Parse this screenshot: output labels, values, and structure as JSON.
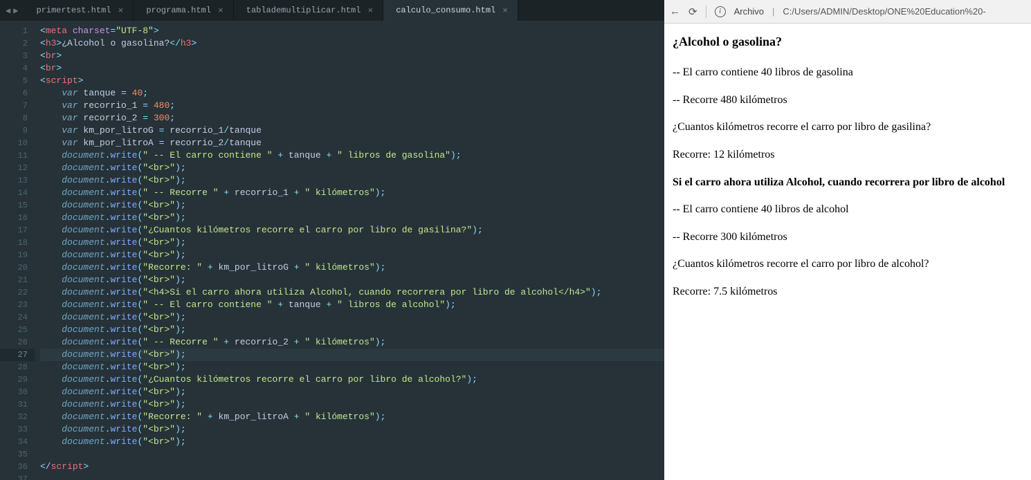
{
  "tabs": {
    "nav_prev": "◀",
    "nav_next": "▶",
    "items": [
      {
        "label": "primertest.html",
        "active": false
      },
      {
        "label": "programa.html",
        "active": false
      },
      {
        "label": "tablademultiplicar.html",
        "active": false
      },
      {
        "label": "calculo_consumo.html",
        "active": true
      }
    ],
    "close_glyph": "×"
  },
  "gutter": {
    "start": 1,
    "end": 37,
    "highlight": 27
  },
  "code_lines": [
    [
      {
        "c": "t-cyan",
        "t": "<"
      },
      {
        "c": "t-red",
        "t": "meta "
      },
      {
        "c": "t-purple",
        "t": "charset"
      },
      {
        "c": "t-cyan",
        "t": "="
      },
      {
        "c": "t-green",
        "t": "\"UTF-8\""
      },
      {
        "c": "t-cyan",
        "t": ">"
      }
    ],
    [
      {
        "c": "t-cyan",
        "t": "<"
      },
      {
        "c": "t-red",
        "t": "h3"
      },
      {
        "c": "t-cyan",
        "t": ">"
      },
      {
        "c": "t-gray",
        "t": "¿Alcohol o gasolina?"
      },
      {
        "c": "t-cyan",
        "t": "</"
      },
      {
        "c": "t-red",
        "t": "h3"
      },
      {
        "c": "t-cyan",
        "t": ">"
      }
    ],
    [
      {
        "c": "t-cyan",
        "t": "<"
      },
      {
        "c": "t-red",
        "t": "br"
      },
      {
        "c": "t-cyan",
        "t": ">"
      }
    ],
    [
      {
        "c": "t-cyan",
        "t": "<"
      },
      {
        "c": "t-red",
        "t": "br"
      },
      {
        "c": "t-cyan",
        "t": ">"
      }
    ],
    [
      {
        "c": "t-cyan",
        "t": "<"
      },
      {
        "c": "t-red",
        "t": "script"
      },
      {
        "c": "t-cyan",
        "t": ">"
      }
    ],
    [
      {
        "c": "",
        "t": "    "
      },
      {
        "c": "t-purple t-ital",
        "t": "var"
      },
      {
        "c": "t-gray",
        "t": " tanque "
      },
      {
        "c": "t-cyan",
        "t": "= "
      },
      {
        "c": "t-orange",
        "t": "40"
      },
      {
        "c": "t-cyan",
        "t": ";"
      }
    ],
    [
      {
        "c": "",
        "t": "    "
      },
      {
        "c": "t-purple t-ital",
        "t": "var"
      },
      {
        "c": "t-gray",
        "t": " recorrio_1 "
      },
      {
        "c": "t-cyan",
        "t": "= "
      },
      {
        "c": "t-orange",
        "t": "480"
      },
      {
        "c": "t-cyan",
        "t": ";"
      }
    ],
    [
      {
        "c": "",
        "t": "    "
      },
      {
        "c": "t-purple t-ital",
        "t": "var"
      },
      {
        "c": "t-gray",
        "t": " recorrio_2 "
      },
      {
        "c": "t-cyan",
        "t": "= "
      },
      {
        "c": "t-orange",
        "t": "300"
      },
      {
        "c": "t-cyan",
        "t": ";"
      }
    ],
    [
      {
        "c": "",
        "t": "    "
      },
      {
        "c": "t-purple t-ital",
        "t": "var"
      },
      {
        "c": "t-gray",
        "t": " km_por_litroG "
      },
      {
        "c": "t-cyan",
        "t": "= "
      },
      {
        "c": "t-gray",
        "t": "recorrio_1"
      },
      {
        "c": "t-cyan",
        "t": "/"
      },
      {
        "c": "t-gray",
        "t": "tanque"
      }
    ],
    [
      {
        "c": "",
        "t": "    "
      },
      {
        "c": "t-purple t-ital",
        "t": "var"
      },
      {
        "c": "t-gray",
        "t": " km_por_litroA "
      },
      {
        "c": "t-cyan",
        "t": "= "
      },
      {
        "c": "t-gray",
        "t": "recorrio_2"
      },
      {
        "c": "t-cyan",
        "t": "/"
      },
      {
        "c": "t-gray",
        "t": "tanque"
      }
    ],
    [
      {
        "c": "",
        "t": "    "
      },
      {
        "c": "t-doc",
        "t": "document"
      },
      {
        "c": "t-cyan",
        "t": "."
      },
      {
        "c": "t-blue",
        "t": "write"
      },
      {
        "c": "t-cyan",
        "t": "("
      },
      {
        "c": "t-green",
        "t": "\" -- El carro contiene \""
      },
      {
        "c": "t-cyan",
        "t": " + "
      },
      {
        "c": "t-gray",
        "t": "tanque"
      },
      {
        "c": "t-cyan",
        "t": " + "
      },
      {
        "c": "t-green",
        "t": "\" libros de gasolina\""
      },
      {
        "c": "t-cyan",
        "t": ");"
      }
    ],
    [
      {
        "c": "",
        "t": "    "
      },
      {
        "c": "t-doc",
        "t": "document"
      },
      {
        "c": "t-cyan",
        "t": "."
      },
      {
        "c": "t-blue",
        "t": "write"
      },
      {
        "c": "t-cyan",
        "t": "("
      },
      {
        "c": "t-green",
        "t": "\"<br>\""
      },
      {
        "c": "t-cyan",
        "t": ");"
      }
    ],
    [
      {
        "c": "",
        "t": "    "
      },
      {
        "c": "t-doc",
        "t": "document"
      },
      {
        "c": "t-cyan",
        "t": "."
      },
      {
        "c": "t-blue",
        "t": "write"
      },
      {
        "c": "t-cyan",
        "t": "("
      },
      {
        "c": "t-green",
        "t": "\"<br>\""
      },
      {
        "c": "t-cyan",
        "t": ");"
      }
    ],
    [
      {
        "c": "",
        "t": "    "
      },
      {
        "c": "t-doc",
        "t": "document"
      },
      {
        "c": "t-cyan",
        "t": "."
      },
      {
        "c": "t-blue",
        "t": "write"
      },
      {
        "c": "t-cyan",
        "t": "("
      },
      {
        "c": "t-green",
        "t": "\" -- Recorre \""
      },
      {
        "c": "t-cyan",
        "t": " + "
      },
      {
        "c": "t-gray",
        "t": "recorrio_1"
      },
      {
        "c": "t-cyan",
        "t": " + "
      },
      {
        "c": "t-green",
        "t": "\" kilómetros\""
      },
      {
        "c": "t-cyan",
        "t": ");"
      }
    ],
    [
      {
        "c": "",
        "t": "    "
      },
      {
        "c": "t-doc",
        "t": "document"
      },
      {
        "c": "t-cyan",
        "t": "."
      },
      {
        "c": "t-blue",
        "t": "write"
      },
      {
        "c": "t-cyan",
        "t": "("
      },
      {
        "c": "t-green",
        "t": "\"<br>\""
      },
      {
        "c": "t-cyan",
        "t": ");"
      }
    ],
    [
      {
        "c": "",
        "t": "    "
      },
      {
        "c": "t-doc",
        "t": "document"
      },
      {
        "c": "t-cyan",
        "t": "."
      },
      {
        "c": "t-blue",
        "t": "write"
      },
      {
        "c": "t-cyan",
        "t": "("
      },
      {
        "c": "t-green",
        "t": "\"<br>\""
      },
      {
        "c": "t-cyan",
        "t": ");"
      }
    ],
    [
      {
        "c": "",
        "t": "    "
      },
      {
        "c": "t-doc",
        "t": "document"
      },
      {
        "c": "t-cyan",
        "t": "."
      },
      {
        "c": "t-blue",
        "t": "write"
      },
      {
        "c": "t-cyan",
        "t": "("
      },
      {
        "c": "t-green",
        "t": "\"¿Cuantos kilómetros recorre el carro por libro de gasilina?\""
      },
      {
        "c": "t-cyan",
        "t": ");"
      }
    ],
    [
      {
        "c": "",
        "t": "    "
      },
      {
        "c": "t-doc",
        "t": "document"
      },
      {
        "c": "t-cyan",
        "t": "."
      },
      {
        "c": "t-blue",
        "t": "write"
      },
      {
        "c": "t-cyan",
        "t": "("
      },
      {
        "c": "t-green",
        "t": "\"<br>\""
      },
      {
        "c": "t-cyan",
        "t": ");"
      }
    ],
    [
      {
        "c": "",
        "t": "    "
      },
      {
        "c": "t-doc",
        "t": "document"
      },
      {
        "c": "t-cyan",
        "t": "."
      },
      {
        "c": "t-blue",
        "t": "write"
      },
      {
        "c": "t-cyan",
        "t": "("
      },
      {
        "c": "t-green",
        "t": "\"<br>\""
      },
      {
        "c": "t-cyan",
        "t": ");"
      }
    ],
    [
      {
        "c": "",
        "t": "    "
      },
      {
        "c": "t-doc",
        "t": "document"
      },
      {
        "c": "t-cyan",
        "t": "."
      },
      {
        "c": "t-blue",
        "t": "write"
      },
      {
        "c": "t-cyan",
        "t": "("
      },
      {
        "c": "t-green",
        "t": "\"Recorre: \""
      },
      {
        "c": "t-cyan",
        "t": " + "
      },
      {
        "c": "t-gray",
        "t": "km_por_litroG"
      },
      {
        "c": "t-cyan",
        "t": " + "
      },
      {
        "c": "t-green",
        "t": "\" kilómetros\""
      },
      {
        "c": "t-cyan",
        "t": ");"
      }
    ],
    [
      {
        "c": "",
        "t": "    "
      },
      {
        "c": "t-doc",
        "t": "document"
      },
      {
        "c": "t-cyan",
        "t": "."
      },
      {
        "c": "t-blue",
        "t": "write"
      },
      {
        "c": "t-cyan",
        "t": "("
      },
      {
        "c": "t-green",
        "t": "\"<br>\""
      },
      {
        "c": "t-cyan",
        "t": ");"
      }
    ],
    [
      {
        "c": "",
        "t": "    "
      },
      {
        "c": "t-doc",
        "t": "document"
      },
      {
        "c": "t-cyan",
        "t": "."
      },
      {
        "c": "t-blue",
        "t": "write"
      },
      {
        "c": "t-cyan",
        "t": "("
      },
      {
        "c": "t-green",
        "t": "\"<h4>Si el carro ahora utiliza Alcohol, cuando recorrera por libro de alcohol</h4>\""
      },
      {
        "c": "t-cyan",
        "t": ");"
      }
    ],
    [
      {
        "c": "",
        "t": "    "
      },
      {
        "c": "t-doc",
        "t": "document"
      },
      {
        "c": "t-cyan",
        "t": "."
      },
      {
        "c": "t-blue",
        "t": "write"
      },
      {
        "c": "t-cyan",
        "t": "("
      },
      {
        "c": "t-green",
        "t": "\" -- El carro contiene \""
      },
      {
        "c": "t-cyan",
        "t": " + "
      },
      {
        "c": "t-gray",
        "t": "tanque"
      },
      {
        "c": "t-cyan",
        "t": " + "
      },
      {
        "c": "t-green",
        "t": "\" libros de alcohol\""
      },
      {
        "c": "t-cyan",
        "t": ");"
      }
    ],
    [
      {
        "c": "",
        "t": "    "
      },
      {
        "c": "t-doc",
        "t": "document"
      },
      {
        "c": "t-cyan",
        "t": "."
      },
      {
        "c": "t-blue",
        "t": "write"
      },
      {
        "c": "t-cyan",
        "t": "("
      },
      {
        "c": "t-green",
        "t": "\"<br>\""
      },
      {
        "c": "t-cyan",
        "t": ");"
      }
    ],
    [
      {
        "c": "",
        "t": "    "
      },
      {
        "c": "t-doc",
        "t": "document"
      },
      {
        "c": "t-cyan",
        "t": "."
      },
      {
        "c": "t-blue",
        "t": "write"
      },
      {
        "c": "t-cyan",
        "t": "("
      },
      {
        "c": "t-green",
        "t": "\"<br>\""
      },
      {
        "c": "t-cyan",
        "t": ");"
      }
    ],
    [
      {
        "c": "",
        "t": "    "
      },
      {
        "c": "t-doc",
        "t": "document"
      },
      {
        "c": "t-cyan",
        "t": "."
      },
      {
        "c": "t-blue",
        "t": "write"
      },
      {
        "c": "t-cyan",
        "t": "("
      },
      {
        "c": "t-green",
        "t": "\" -- Recorre \""
      },
      {
        "c": "t-cyan",
        "t": " + "
      },
      {
        "c": "t-gray",
        "t": "recorrio_2"
      },
      {
        "c": "t-cyan",
        "t": " + "
      },
      {
        "c": "t-green",
        "t": "\" kilómetros\""
      },
      {
        "c": "t-cyan",
        "t": ");"
      }
    ],
    [
      {
        "c": "",
        "t": "    "
      },
      {
        "c": "t-doc",
        "t": "document"
      },
      {
        "c": "t-cyan",
        "t": "."
      },
      {
        "c": "t-blue",
        "t": "write"
      },
      {
        "c": "t-cyan",
        "t": "("
      },
      {
        "c": "t-green",
        "t": "\"<br>\""
      },
      {
        "c": "t-cyan",
        "t": ");"
      }
    ],
    [
      {
        "c": "",
        "t": "    "
      },
      {
        "c": "t-doc",
        "t": "document"
      },
      {
        "c": "t-cyan",
        "t": "."
      },
      {
        "c": "t-blue",
        "t": "write"
      },
      {
        "c": "t-cyan",
        "t": "("
      },
      {
        "c": "t-green",
        "t": "\"<br>\""
      },
      {
        "c": "t-cyan",
        "t": ");"
      }
    ],
    [
      {
        "c": "",
        "t": "    "
      },
      {
        "c": "t-doc",
        "t": "document"
      },
      {
        "c": "t-cyan",
        "t": "."
      },
      {
        "c": "t-blue",
        "t": "write"
      },
      {
        "c": "t-cyan",
        "t": "("
      },
      {
        "c": "t-green",
        "t": "\"¿Cuantos kilómetros recorre el carro por libro de alcohol?\""
      },
      {
        "c": "t-cyan",
        "t": ");"
      }
    ],
    [
      {
        "c": "",
        "t": "    "
      },
      {
        "c": "t-doc",
        "t": "document"
      },
      {
        "c": "t-cyan",
        "t": "."
      },
      {
        "c": "t-blue",
        "t": "write"
      },
      {
        "c": "t-cyan",
        "t": "("
      },
      {
        "c": "t-green",
        "t": "\"<br>\""
      },
      {
        "c": "t-cyan",
        "t": ");"
      }
    ],
    [
      {
        "c": "",
        "t": "    "
      },
      {
        "c": "t-doc",
        "t": "document"
      },
      {
        "c": "t-cyan",
        "t": "."
      },
      {
        "c": "t-blue",
        "t": "write"
      },
      {
        "c": "t-cyan",
        "t": "("
      },
      {
        "c": "t-green",
        "t": "\"<br>\""
      },
      {
        "c": "t-cyan",
        "t": ");"
      }
    ],
    [
      {
        "c": "",
        "t": "    "
      },
      {
        "c": "t-doc",
        "t": "document"
      },
      {
        "c": "t-cyan",
        "t": "."
      },
      {
        "c": "t-blue",
        "t": "write"
      },
      {
        "c": "t-cyan",
        "t": "("
      },
      {
        "c": "t-green",
        "t": "\"Recorre: \""
      },
      {
        "c": "t-cyan",
        "t": " + "
      },
      {
        "c": "t-gray",
        "t": "km_por_litroA"
      },
      {
        "c": "t-cyan",
        "t": " + "
      },
      {
        "c": "t-green",
        "t": "\" kilómetros\""
      },
      {
        "c": "t-cyan",
        "t": ");"
      }
    ],
    [
      {
        "c": "",
        "t": "    "
      },
      {
        "c": "t-doc",
        "t": "document"
      },
      {
        "c": "t-cyan",
        "t": "."
      },
      {
        "c": "t-blue",
        "t": "write"
      },
      {
        "c": "t-cyan",
        "t": "("
      },
      {
        "c": "t-green",
        "t": "\"<br>\""
      },
      {
        "c": "t-cyan",
        "t": ");"
      }
    ],
    [
      {
        "c": "",
        "t": "    "
      },
      {
        "c": "t-doc",
        "t": "document"
      },
      {
        "c": "t-cyan",
        "t": "."
      },
      {
        "c": "t-blue",
        "t": "write"
      },
      {
        "c": "t-cyan",
        "t": "("
      },
      {
        "c": "t-green",
        "t": "\"<br>\""
      },
      {
        "c": "t-cyan",
        "t": ");"
      }
    ],
    [],
    [
      {
        "c": "t-cyan",
        "t": "</"
      },
      {
        "c": "t-red",
        "t": "script"
      },
      {
        "c": "t-cyan",
        "t": ">"
      }
    ],
    []
  ],
  "browser": {
    "nav_back": "←",
    "nav_reload": "⟳",
    "url_label_prefix": "Archivo",
    "url_path": "C:/Users/ADMIN/Desktop/ONE%20Education%20-",
    "info_glyph": "i",
    "divider": "|",
    "content": {
      "title": "¿Alcohol o gasolina?",
      "p1": "-- El carro contiene 40 libros de gasolina",
      "p2": "-- Recorre 480 kilómetros",
      "p3": "¿Cuantos kilómetros recorre el carro por libro de gasilina?",
      "p4": "Recorre: 12 kilómetros",
      "h4": "Si el carro ahora utiliza Alcohol, cuando recorrera por libro de alcohol",
      "p5": "-- El carro contiene 40 libros de alcohol",
      "p6": "-- Recorre 300 kilómetros",
      "p7": "¿Cuantos kilómetros recorre el carro por libro de alcohol?",
      "p8": "Recorre: 7.5 kilómetros"
    }
  }
}
